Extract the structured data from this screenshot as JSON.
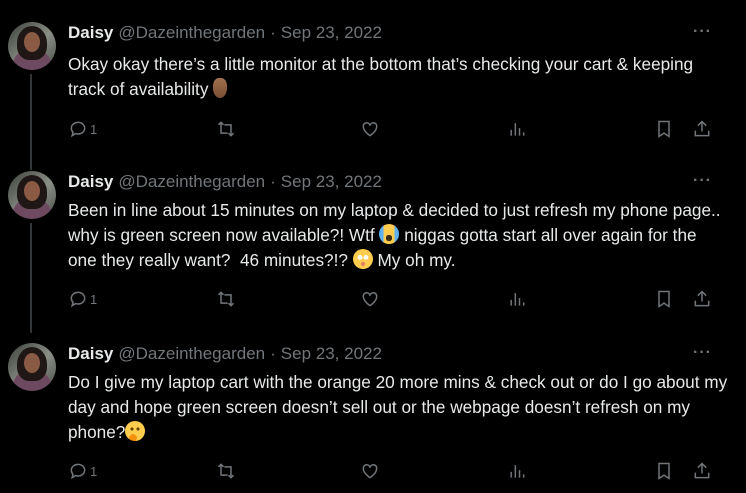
{
  "tweets": [
    {
      "name": "Daisy",
      "handle": "@Dazeinthegarden",
      "separator": "·",
      "date": "Sep 23, 2022",
      "more": "···",
      "text": "Okay okay there’s a little monitor at the bottom that’s checking your cart & keeping track of availability",
      "emoji": [
        "crossed-fingers-emoji"
      ],
      "reply_count": "1"
    },
    {
      "name": "Daisy",
      "handle": "@Dazeinthegarden",
      "separator": "·",
      "date": "Sep 23, 2022",
      "more": "···",
      "text_1": "Been in line about 15 minutes on my laptop & decided to just refresh my phone page.. why is green screen now available?! Wtf ",
      "text_2": " niggas gotta start all over again for the one they really want?  46 minutes?!? ",
      "text_3": " My oh my.",
      "emoji": [
        "loudly-crying-face-emoji",
        "flushed-face-emoji"
      ],
      "reply_count": "1"
    },
    {
      "name": "Daisy",
      "handle": "@Dazeinthegarden",
      "separator": "·",
      "date": "Sep 23, 2022",
      "more": "···",
      "text": "Do I give my laptop cart with the orange 20 more mins & check out or do I go about my day and hope green screen doesn’t sell out or the webpage doesn’t refresh on my phone?",
      "emoji": [
        "thinking-face-emoji"
      ],
      "reply_count": "1"
    }
  ],
  "colors": {
    "background": "#000000",
    "text": "#e7e9ea",
    "muted": "#71767b",
    "thread_line": "#333639"
  },
  "icons": [
    "reply-icon",
    "retweet-icon",
    "like-icon",
    "views-icon",
    "bookmark-icon",
    "share-icon"
  ]
}
